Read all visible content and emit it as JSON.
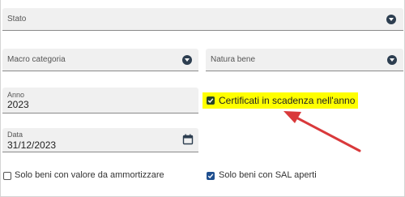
{
  "stato": {
    "label": "Stato",
    "value": ""
  },
  "macro_categoria": {
    "label": "Macro categoria",
    "value": ""
  },
  "natura_bene": {
    "label": "Natura bene",
    "value": ""
  },
  "anno": {
    "label": "Anno",
    "value": "2023"
  },
  "data": {
    "label": "Data",
    "value": "31/12/2023"
  },
  "certificati": {
    "label": "Certificati in scadenza nell'anno",
    "checked": true,
    "highlight_color": "#ffff00"
  },
  "solo_beni_ammortizzare": {
    "label": "Solo beni con valore da ammortizzare",
    "checked": false
  },
  "solo_beni_sal": {
    "label": "Solo beni con SAL aperti",
    "checked": true
  },
  "annotation": {
    "arrow_color": "#d9393b"
  },
  "icons": {
    "dropdown": "chevron-down-icon",
    "calendar": "calendar-icon",
    "check": "check-icon"
  },
  "colors": {
    "checkbox_checked": "#1f4f8f",
    "dropdown_button": "#2d3e50",
    "field_background": "#f0f0f0"
  }
}
